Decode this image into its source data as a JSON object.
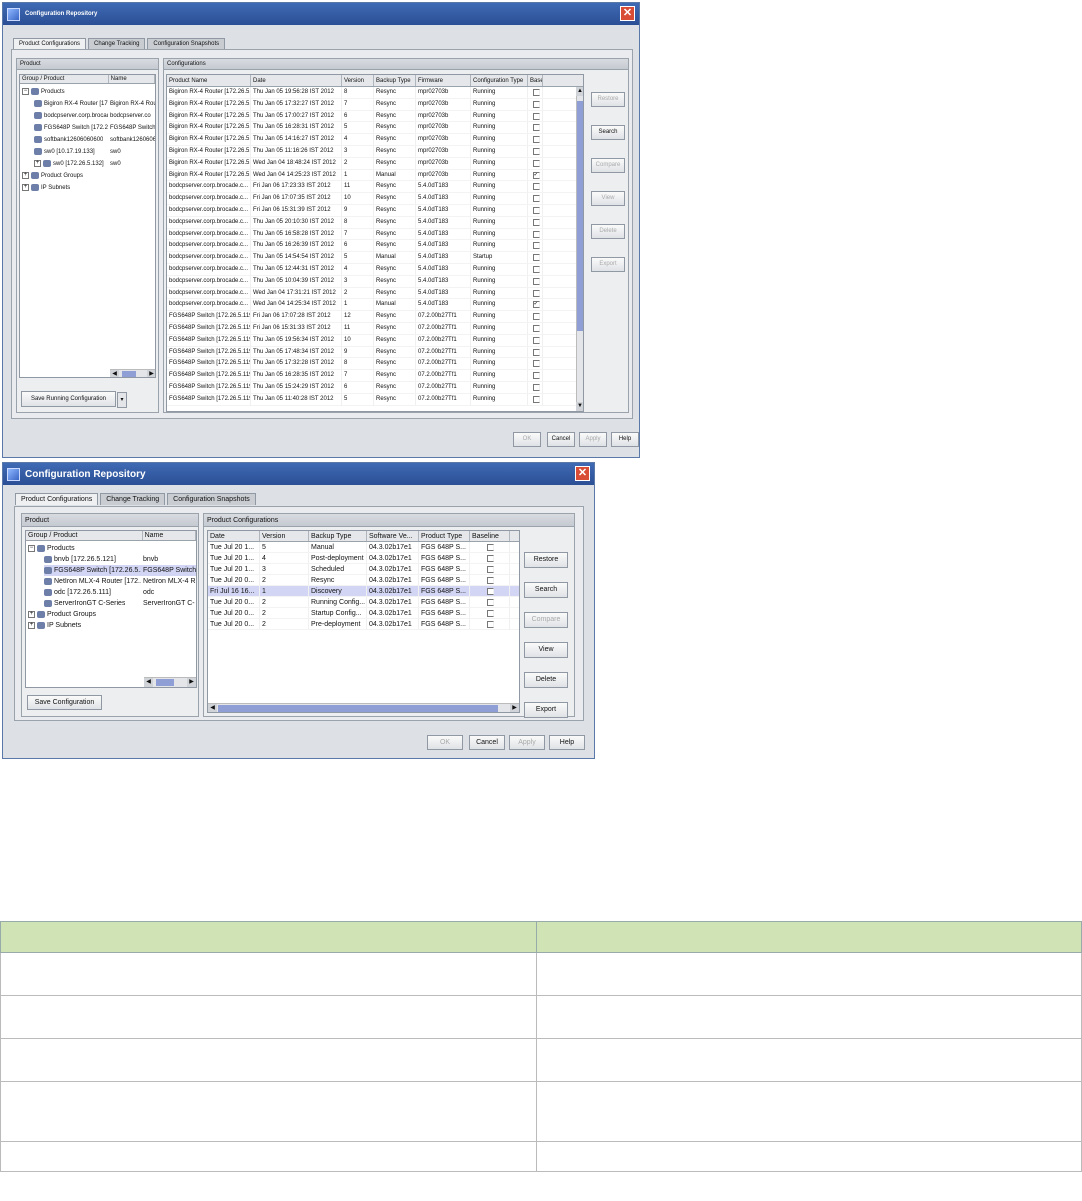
{
  "window1": {
    "title": "Configuration Repository",
    "tabs": [
      "Product Configurations",
      "Change Tracking",
      "Configuration Snapshots"
    ],
    "product_panel_title": "Product",
    "tree_header": [
      "Group / Product",
      "Name"
    ],
    "tree": [
      {
        "label": "Products",
        "name": "",
        "expander": "−"
      },
      {
        "label": "Bigiron RX-4 Router [172.26.5...",
        "name": "Bigiron RX-4 Rou",
        "expander": ""
      },
      {
        "label": "bodcpserver.corp.brocade.co...",
        "name": "bodcpserver.co",
        "expander": ""
      },
      {
        "label": "FGS648P Switch [172.26.5.119]",
        "name": "FGS648P Switch",
        "expander": ""
      },
      {
        "label": "softbank12606060600",
        "name": "softbank1260606",
        "expander": ""
      },
      {
        "label": "sw0 [10.17.19.133]",
        "name": "sw0",
        "expander": ""
      },
      {
        "label": "sw0 [172.26.5.132]",
        "name": "sw0",
        "expander": "+"
      },
      {
        "label": "Product Groups",
        "name": "",
        "expander": "+"
      },
      {
        "label": "IP Subnets",
        "name": "",
        "expander": "+"
      }
    ],
    "save_button": "Save Running Configuration",
    "config_panel_title": "Configurations",
    "columns": [
      "Product Name",
      "Date",
      "Version",
      "Backup Type",
      "Firmware",
      "Configuration Type",
      "Baseline"
    ],
    "rows": [
      [
        "Bigiron RX-4 Router [172.26.5...",
        "Thu Jan 05 19:56:28 IST 2012",
        "8",
        "Resync",
        "mpr02703b",
        "Running",
        false
      ],
      [
        "Bigiron RX-4 Router [172.26.5...",
        "Thu Jan 05 17:32:27 IST 2012",
        "7",
        "Resync",
        "mpr02703b",
        "Running",
        false
      ],
      [
        "Bigiron RX-4 Router [172.26.5...",
        "Thu Jan 05 17:00:27 IST 2012",
        "6",
        "Resync",
        "mpr02703b",
        "Running",
        false
      ],
      [
        "Bigiron RX-4 Router [172.26.5...",
        "Thu Jan 05 16:28:31 IST 2012",
        "5",
        "Resync",
        "mpr02703b",
        "Running",
        false
      ],
      [
        "Bigiron RX-4 Router [172.26.5...",
        "Thu Jan 05 14:16:27 IST 2012",
        "4",
        "Resync",
        "mpr02703b",
        "Running",
        false
      ],
      [
        "Bigiron RX-4 Router [172.26.5...",
        "Thu Jan 05 11:16:26 IST 2012",
        "3",
        "Resync",
        "mpr02703b",
        "Running",
        false
      ],
      [
        "Bigiron RX-4 Router [172.26.5...",
        "Wed Jan 04 18:48:24 IST 2012",
        "2",
        "Resync",
        "mpr02703b",
        "Running",
        false
      ],
      [
        "Bigiron RX-4 Router [172.26.5...",
        "Wed Jan 04 14:25:23 IST 2012",
        "1",
        "Manual",
        "mpr02703b",
        "Running",
        true
      ],
      [
        "bodcpserver.corp.brocade.c...",
        "Fri Jan 06 17:23:33 IST 2012",
        "11",
        "Resync",
        "5.4.0dT183",
        "Running",
        false
      ],
      [
        "bodcpserver.corp.brocade.c...",
        "Fri Jan 06 17:07:35 IST 2012",
        "10",
        "Resync",
        "5.4.0dT183",
        "Running",
        false
      ],
      [
        "bodcpserver.corp.brocade.c...",
        "Fri Jan 06 15:31:39 IST 2012",
        "9",
        "Resync",
        "5.4.0dT183",
        "Running",
        false
      ],
      [
        "bodcpserver.corp.brocade.c...",
        "Thu Jan 05 20:10:30 IST 2012",
        "8",
        "Resync",
        "5.4.0dT183",
        "Running",
        false
      ],
      [
        "bodcpserver.corp.brocade.c...",
        "Thu Jan 05 16:58:28 IST 2012",
        "7",
        "Resync",
        "5.4.0dT183",
        "Running",
        false
      ],
      [
        "bodcpserver.corp.brocade.c...",
        "Thu Jan 05 16:26:39 IST 2012",
        "6",
        "Resync",
        "5.4.0dT183",
        "Running",
        false
      ],
      [
        "bodcpserver.corp.brocade.c...",
        "Thu Jan 05 14:54:54 IST 2012",
        "5",
        "Manual",
        "5.4.0dT183",
        "Startup",
        false
      ],
      [
        "bodcpserver.corp.brocade.c...",
        "Thu Jan 05 12:44:31 IST 2012",
        "4",
        "Resync",
        "5.4.0dT183",
        "Running",
        false
      ],
      [
        "bodcpserver.corp.brocade.c...",
        "Thu Jan 05 10:04:39 IST 2012",
        "3",
        "Resync",
        "5.4.0dT183",
        "Running",
        false
      ],
      [
        "bodcpserver.corp.brocade.c...",
        "Wed Jan 04 17:31:21 IST 2012",
        "2",
        "Resync",
        "5.4.0dT183",
        "Running",
        false
      ],
      [
        "bodcpserver.corp.brocade.c...",
        "Wed Jan 04 14:25:34 IST 2012",
        "1",
        "Manual",
        "5.4.0dT183",
        "Running",
        true
      ],
      [
        "FGS648P Switch [172.26.5.119]",
        "Fri Jan 06 17:07:28 IST 2012",
        "12",
        "Resync",
        "07.2.00b27Tf1",
        "Running",
        false
      ],
      [
        "FGS648P Switch [172.26.5.119]",
        "Fri Jan 06 15:31:33 IST 2012",
        "11",
        "Resync",
        "07.2.00b27Tf1",
        "Running",
        false
      ],
      [
        "FGS648P Switch [172.26.5.119]",
        "Thu Jan 05 19:56:34 IST 2012",
        "10",
        "Resync",
        "07.2.00b27Tf1",
        "Running",
        false
      ],
      [
        "FGS648P Switch [172.26.5.119]",
        "Thu Jan 05 17:48:34 IST 2012",
        "9",
        "Resync",
        "07.2.00b27Tf1",
        "Running",
        false
      ],
      [
        "FGS648P Switch [172.26.5.119]",
        "Thu Jan 05 17:32:28 IST 2012",
        "8",
        "Resync",
        "07.2.00b27Tf1",
        "Running",
        false
      ],
      [
        "FGS648P Switch [172.26.5.119]",
        "Thu Jan 05 16:28:35 IST 2012",
        "7",
        "Resync",
        "07.2.00b27Tf1",
        "Running",
        false
      ],
      [
        "FGS648P Switch [172.26.5.119]",
        "Thu Jan 05 15:24:29 IST 2012",
        "6",
        "Resync",
        "07.2.00b27Tf1",
        "Running",
        false
      ],
      [
        "FGS648P Switch [172.26.5.119]",
        "Thu Jan 05 11:40:28 IST 2012",
        "5",
        "Resync",
        "07.2.00b27Tf1",
        "Running",
        false
      ]
    ],
    "side_buttons": [
      {
        "label": "Restore",
        "enabled": false
      },
      {
        "label": "Search",
        "enabled": true
      },
      {
        "label": "Compare",
        "enabled": false
      },
      {
        "label": "View",
        "enabled": false
      },
      {
        "label": "Delete",
        "enabled": false
      },
      {
        "label": "Export",
        "enabled": false
      }
    ],
    "footer_buttons": [
      {
        "label": "OK",
        "enabled": false
      },
      {
        "label": "Cancel",
        "enabled": true
      },
      {
        "label": "Apply",
        "enabled": false
      },
      {
        "label": "Help",
        "enabled": true
      }
    ]
  },
  "window2": {
    "title": "Configuration Repository",
    "tabs": [
      "Product Configurations",
      "Change Tracking",
      "Configuration Snapshots"
    ],
    "product_panel_title": "Product",
    "tree_header": [
      "Group / Product",
      "Name"
    ],
    "tree": [
      {
        "label": "Products",
        "name": "",
        "expander": "−"
      },
      {
        "label": "bnvb [172.26.5.121]",
        "name": "bnvb",
        "expander": ""
      },
      {
        "label": "FGS648P Switch [172.26.5.119]",
        "name": "FGS648P Switch",
        "expander": ""
      },
      {
        "label": "NetIron MLX-4 Router [172...",
        "name": "NetIron MLX-4 R",
        "expander": ""
      },
      {
        "label": "odc [172.26.5.111]",
        "name": "odc",
        "expander": ""
      },
      {
        "label": "ServerIronGT C-Series",
        "name": "ServerIronGT C-",
        "expander": ""
      },
      {
        "label": "Product Groups",
        "name": "",
        "expander": "+"
      },
      {
        "label": "IP Subnets",
        "name": "",
        "expander": "+"
      }
    ],
    "save_button": "Save Configuration",
    "config_panel_title": "Product Configurations",
    "columns": [
      "Date",
      "Version",
      "Backup Type",
      "Software Ve...",
      "Product Type",
      "Baseline"
    ],
    "rows": [
      [
        "Tue Jul 20 1...",
        "5",
        "Manual",
        "04.3.02b17e1",
        "FGS 648P S...",
        false
      ],
      [
        "Tue Jul 20 1...",
        "4",
        "Post-deployment",
        "04.3.02b17e1",
        "FGS 648P S...",
        false
      ],
      [
        "Tue Jul 20 1...",
        "3",
        "Scheduled",
        "04.3.02b17e1",
        "FGS 648P S...",
        false
      ],
      [
        "Tue Jul 20 0...",
        "2",
        "Resync",
        "04.3.02b17e1",
        "FGS 648P S...",
        false
      ],
      [
        "Fri Jul 16 16...",
        "1",
        "Discovery",
        "04.3.02b17e1",
        "FGS 648P S...",
        false
      ],
      [
        "Tue Jul 20 0...",
        "2",
        "Running Config...",
        "04.3.02b17e1",
        "FGS 648P S...",
        false
      ],
      [
        "Tue Jul 20 0...",
        "2",
        "Startup Config...",
        "04.3.02b17e1",
        "FGS 648P S...",
        false
      ],
      [
        "Tue Jul 20 0...",
        "2",
        "Pre-deployment",
        "04.3.02b17e1",
        "FGS 648P S...",
        false
      ]
    ],
    "selected_row": 4,
    "side_buttons": [
      {
        "label": "Restore",
        "enabled": true
      },
      {
        "label": "Search",
        "enabled": true
      },
      {
        "label": "Compare",
        "enabled": false
      },
      {
        "label": "View",
        "enabled": true
      },
      {
        "label": "Delete",
        "enabled": true
      },
      {
        "label": "Export",
        "enabled": true
      }
    ],
    "footer_buttons": [
      {
        "label": "OK",
        "enabled": false
      },
      {
        "label": "Cancel",
        "enabled": true
      },
      {
        "label": "Apply",
        "enabled": false
      },
      {
        "label": "Help",
        "enabled": true
      }
    ]
  },
  "doc_table": {
    "headers": [
      "",
      ""
    ],
    "rows": [
      [
        "",
        ""
      ],
      [
        "",
        ""
      ],
      [
        "",
        ""
      ],
      [
        "",
        ""
      ],
      [
        "",
        ""
      ]
    ]
  },
  "colors": {
    "title_bar": "#2b4f95",
    "selection": "#d2d5f3",
    "table_header": "#cfe3b4",
    "close_button": "#d94c35"
  },
  "icons": [
    "app-icon",
    "close-icon",
    "product-node-icon",
    "expand-icon",
    "scroll-arrow-icon"
  ]
}
